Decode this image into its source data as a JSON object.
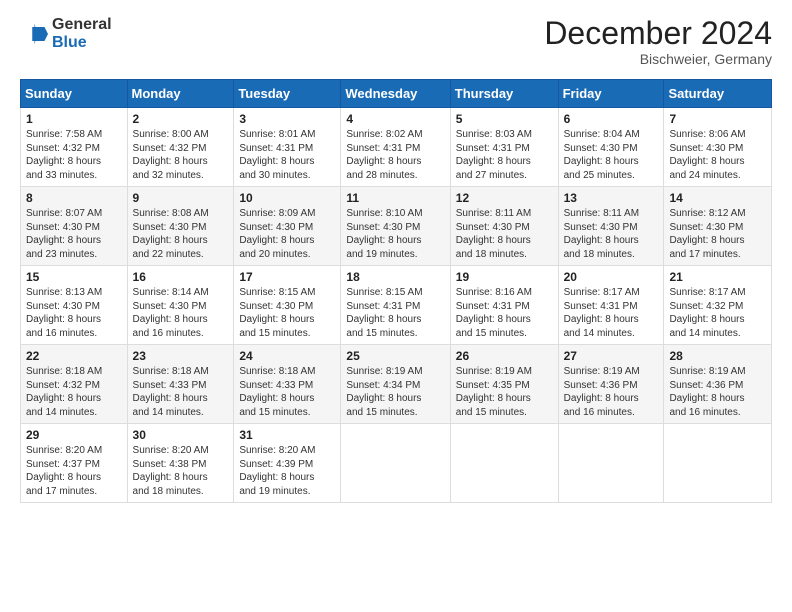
{
  "header": {
    "logo_general": "General",
    "logo_blue": "Blue",
    "month_title": "December 2024",
    "location": "Bischweier, Germany"
  },
  "days_of_week": [
    "Sunday",
    "Monday",
    "Tuesday",
    "Wednesday",
    "Thursday",
    "Friday",
    "Saturday"
  ],
  "weeks": [
    [
      {
        "day": "1",
        "lines": [
          "Sunrise: 7:58 AM",
          "Sunset: 4:32 PM",
          "Daylight: 8 hours",
          "and 33 minutes."
        ]
      },
      {
        "day": "2",
        "lines": [
          "Sunrise: 8:00 AM",
          "Sunset: 4:32 PM",
          "Daylight: 8 hours",
          "and 32 minutes."
        ]
      },
      {
        "day": "3",
        "lines": [
          "Sunrise: 8:01 AM",
          "Sunset: 4:31 PM",
          "Daylight: 8 hours",
          "and 30 minutes."
        ]
      },
      {
        "day": "4",
        "lines": [
          "Sunrise: 8:02 AM",
          "Sunset: 4:31 PM",
          "Daylight: 8 hours",
          "and 28 minutes."
        ]
      },
      {
        "day": "5",
        "lines": [
          "Sunrise: 8:03 AM",
          "Sunset: 4:31 PM",
          "Daylight: 8 hours",
          "and 27 minutes."
        ]
      },
      {
        "day": "6",
        "lines": [
          "Sunrise: 8:04 AM",
          "Sunset: 4:30 PM",
          "Daylight: 8 hours",
          "and 25 minutes."
        ]
      },
      {
        "day": "7",
        "lines": [
          "Sunrise: 8:06 AM",
          "Sunset: 4:30 PM",
          "Daylight: 8 hours",
          "and 24 minutes."
        ]
      }
    ],
    [
      {
        "day": "8",
        "lines": [
          "Sunrise: 8:07 AM",
          "Sunset: 4:30 PM",
          "Daylight: 8 hours",
          "and 23 minutes."
        ]
      },
      {
        "day": "9",
        "lines": [
          "Sunrise: 8:08 AM",
          "Sunset: 4:30 PM",
          "Daylight: 8 hours",
          "and 22 minutes."
        ]
      },
      {
        "day": "10",
        "lines": [
          "Sunrise: 8:09 AM",
          "Sunset: 4:30 PM",
          "Daylight: 8 hours",
          "and 20 minutes."
        ]
      },
      {
        "day": "11",
        "lines": [
          "Sunrise: 8:10 AM",
          "Sunset: 4:30 PM",
          "Daylight: 8 hours",
          "and 19 minutes."
        ]
      },
      {
        "day": "12",
        "lines": [
          "Sunrise: 8:11 AM",
          "Sunset: 4:30 PM",
          "Daylight: 8 hours",
          "and 18 minutes."
        ]
      },
      {
        "day": "13",
        "lines": [
          "Sunrise: 8:11 AM",
          "Sunset: 4:30 PM",
          "Daylight: 8 hours",
          "and 18 minutes."
        ]
      },
      {
        "day": "14",
        "lines": [
          "Sunrise: 8:12 AM",
          "Sunset: 4:30 PM",
          "Daylight: 8 hours",
          "and 17 minutes."
        ]
      }
    ],
    [
      {
        "day": "15",
        "lines": [
          "Sunrise: 8:13 AM",
          "Sunset: 4:30 PM",
          "Daylight: 8 hours",
          "and 16 minutes."
        ]
      },
      {
        "day": "16",
        "lines": [
          "Sunrise: 8:14 AM",
          "Sunset: 4:30 PM",
          "Daylight: 8 hours",
          "and 16 minutes."
        ]
      },
      {
        "day": "17",
        "lines": [
          "Sunrise: 8:15 AM",
          "Sunset: 4:30 PM",
          "Daylight: 8 hours",
          "and 15 minutes."
        ]
      },
      {
        "day": "18",
        "lines": [
          "Sunrise: 8:15 AM",
          "Sunset: 4:31 PM",
          "Daylight: 8 hours",
          "and 15 minutes."
        ]
      },
      {
        "day": "19",
        "lines": [
          "Sunrise: 8:16 AM",
          "Sunset: 4:31 PM",
          "Daylight: 8 hours",
          "and 15 minutes."
        ]
      },
      {
        "day": "20",
        "lines": [
          "Sunrise: 8:17 AM",
          "Sunset: 4:31 PM",
          "Daylight: 8 hours",
          "and 14 minutes."
        ]
      },
      {
        "day": "21",
        "lines": [
          "Sunrise: 8:17 AM",
          "Sunset: 4:32 PM",
          "Daylight: 8 hours",
          "and 14 minutes."
        ]
      }
    ],
    [
      {
        "day": "22",
        "lines": [
          "Sunrise: 8:18 AM",
          "Sunset: 4:32 PM",
          "Daylight: 8 hours",
          "and 14 minutes."
        ]
      },
      {
        "day": "23",
        "lines": [
          "Sunrise: 8:18 AM",
          "Sunset: 4:33 PM",
          "Daylight: 8 hours",
          "and 14 minutes."
        ]
      },
      {
        "day": "24",
        "lines": [
          "Sunrise: 8:18 AM",
          "Sunset: 4:33 PM",
          "Daylight: 8 hours",
          "and 15 minutes."
        ]
      },
      {
        "day": "25",
        "lines": [
          "Sunrise: 8:19 AM",
          "Sunset: 4:34 PM",
          "Daylight: 8 hours",
          "and 15 minutes."
        ]
      },
      {
        "day": "26",
        "lines": [
          "Sunrise: 8:19 AM",
          "Sunset: 4:35 PM",
          "Daylight: 8 hours",
          "and 15 minutes."
        ]
      },
      {
        "day": "27",
        "lines": [
          "Sunrise: 8:19 AM",
          "Sunset: 4:36 PM",
          "Daylight: 8 hours",
          "and 16 minutes."
        ]
      },
      {
        "day": "28",
        "lines": [
          "Sunrise: 8:19 AM",
          "Sunset: 4:36 PM",
          "Daylight: 8 hours",
          "and 16 minutes."
        ]
      }
    ],
    [
      {
        "day": "29",
        "lines": [
          "Sunrise: 8:20 AM",
          "Sunset: 4:37 PM",
          "Daylight: 8 hours",
          "and 17 minutes."
        ]
      },
      {
        "day": "30",
        "lines": [
          "Sunrise: 8:20 AM",
          "Sunset: 4:38 PM",
          "Daylight: 8 hours",
          "and 18 minutes."
        ]
      },
      {
        "day": "31",
        "lines": [
          "Sunrise: 8:20 AM",
          "Sunset: 4:39 PM",
          "Daylight: 8 hours",
          "and 19 minutes."
        ]
      },
      null,
      null,
      null,
      null
    ]
  ]
}
